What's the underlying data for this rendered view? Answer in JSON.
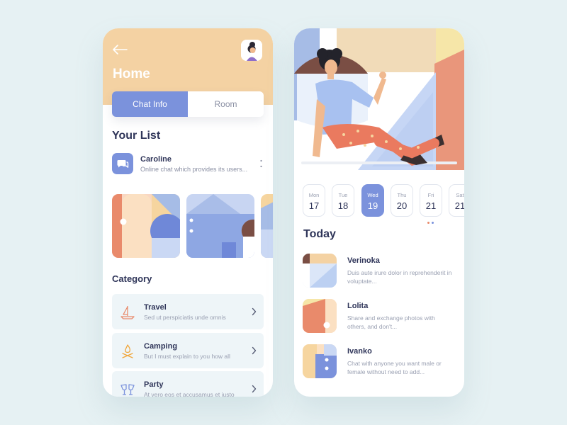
{
  "left": {
    "title": "Home",
    "tabs": [
      {
        "label": "Chat Info",
        "active": true
      },
      {
        "label": "Room",
        "active": false
      }
    ],
    "list_title": "Your List",
    "chat": {
      "name": "Caroline",
      "message": "Online chat which provides its users..."
    },
    "category_title": "Category",
    "categories": [
      {
        "name": "Travel",
        "desc": "Sed ut perspiciatis unde omnis",
        "icon": "sailboat-icon"
      },
      {
        "name": "Camping",
        "desc": "But I must explain to you how all",
        "icon": "campfire-icon"
      },
      {
        "name": "Party",
        "desc": "At vero eos et accusamus et iusto",
        "icon": "cheers-icon"
      }
    ]
  },
  "right": {
    "days": [
      {
        "name": "Mon",
        "num": "17"
      },
      {
        "name": "Tue",
        "num": "18"
      },
      {
        "name": "Wed",
        "num": "19",
        "active": true
      },
      {
        "name": "Thu",
        "num": "20"
      },
      {
        "name": "Fri",
        "num": "21"
      },
      {
        "name": "Sat",
        "num": "21"
      }
    ],
    "today_title": "Today",
    "items": [
      {
        "name": "Verinoka",
        "desc": "Duis aute irure dolor in reprehenderit in voluptate..."
      },
      {
        "name": "Lolita",
        "desc": "Share and exchange photos with others, and don't..."
      },
      {
        "name": "Ivanko",
        "desc": "Chat with anyone you want male or female without need to add..."
      }
    ]
  },
  "colors": {
    "accent": "#7b92dc",
    "header": "#f4d2a3",
    "text": "#2f3559",
    "muted": "#9aa0b2",
    "background": "#e6f1f3",
    "coral": "#e98a6b",
    "blush": "#f9d7c2"
  }
}
